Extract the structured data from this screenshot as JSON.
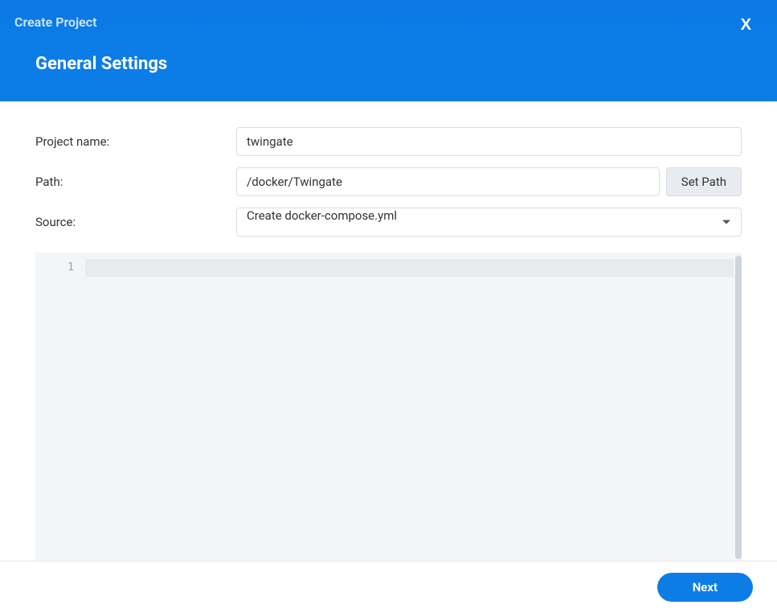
{
  "header": {
    "title": "Create Project",
    "subtitle": "General Settings"
  },
  "form": {
    "project_name_label": "Project name:",
    "project_name_value": "twingate",
    "path_label": "Path:",
    "path_value": "/docker/Twingate",
    "set_path_label": "Set Path",
    "source_label": "Source:",
    "source_value": "Create docker-compose.yml"
  },
  "editor": {
    "line_number": "1",
    "content": ""
  },
  "footer": {
    "next_label": "Next"
  }
}
